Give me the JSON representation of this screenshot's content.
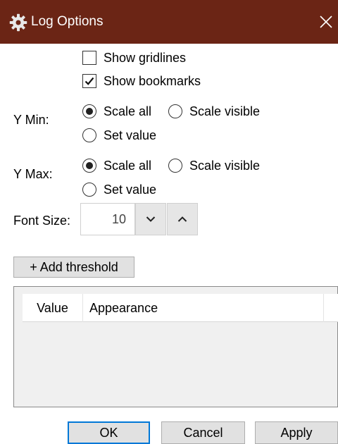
{
  "window": {
    "title": "Log Options",
    "title_icon": "gear-icon",
    "close_icon": "close-icon",
    "titlebar_color": "#6b2515"
  },
  "options": {
    "show_gridlines": {
      "label": "Show gridlines",
      "checked": false
    },
    "show_bookmarks": {
      "label": "Show bookmarks",
      "checked": true
    }
  },
  "y_min": {
    "label": "Y Min:",
    "options": [
      "Scale all",
      "Scale visible",
      "Set value"
    ],
    "selected": "Scale all"
  },
  "y_max": {
    "label": "Y Max:",
    "options": [
      "Scale all",
      "Scale visible",
      "Set value"
    ],
    "selected": "Scale all"
  },
  "font_size": {
    "label": "Font Size:",
    "value": "10",
    "down_icon": "chevron-down-icon",
    "up_icon": "chevron-up-icon"
  },
  "thresholds": {
    "add_label": "+ Add threshold",
    "columns": [
      "Value",
      "Appearance"
    ],
    "rows": []
  },
  "footer": {
    "ok_label": "OK",
    "cancel_label": "Cancel",
    "apply_label": "Apply",
    "accent_color": "#0078d7"
  }
}
